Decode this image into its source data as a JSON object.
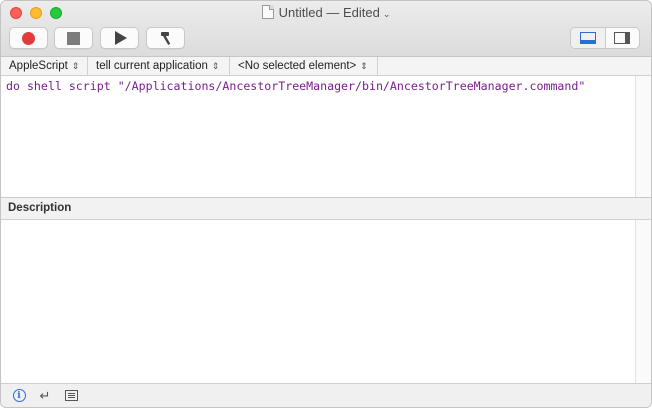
{
  "window": {
    "title": "Untitled — Edited",
    "title_chevron": "⌄"
  },
  "navbar": {
    "language": "AppleScript",
    "target": "tell current application",
    "element": "<No selected element>",
    "updown_glyph": "⇕"
  },
  "editor": {
    "keyword": "do shell script",
    "string_literal": "\"/Applications/AncestorTreeManager/bin/AncestorTreeManager.command\""
  },
  "description": {
    "header": "Description",
    "text": ""
  },
  "colors": {
    "accent": "#2b6cd6",
    "record": "#e23b3b",
    "code": "#7a1e8c"
  },
  "icons": {
    "record": "record-icon",
    "stop": "stop-icon",
    "run": "play-icon",
    "compile": "hammer-icon",
    "show_log": "bottom-pane-icon",
    "show_inspector": "side-pane-icon",
    "info": "info-icon",
    "return": "return-icon",
    "list": "list-icon"
  }
}
